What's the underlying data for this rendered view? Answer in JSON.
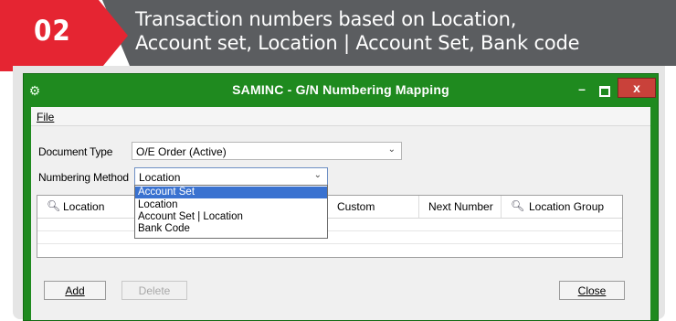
{
  "banner": {
    "step": "02",
    "line1": "Transaction numbers based on Location,",
    "line2": "Account set, Location | Account Set, Bank code"
  },
  "window": {
    "title": "SAMINC - G/N Numbering Mapping",
    "minimize": "–",
    "close": "x"
  },
  "menu": {
    "file": "File"
  },
  "form": {
    "document_type_label": "Document Type",
    "document_type_value": "O/E Order (Active)",
    "numbering_method_label": "Numbering Method",
    "numbering_method_value": "Location"
  },
  "dropdown": {
    "options": [
      "Account Set",
      "Location",
      "Account Set | Location",
      "Bank Code"
    ],
    "selected": "Account Set"
  },
  "grid": {
    "columns": [
      "Location",
      "Custom",
      "Next Number",
      "Location Group"
    ]
  },
  "buttons": {
    "add": "Add",
    "delete": "Delete",
    "close": "Close"
  },
  "colors": {
    "titlebar": "#1f8a1f",
    "banner_red": "#e52532",
    "banner_gray": "#5b5d60",
    "selection": "#3a72d0"
  },
  "icons": {
    "window": "gear-icon",
    "finder": "magnifier-icon"
  }
}
